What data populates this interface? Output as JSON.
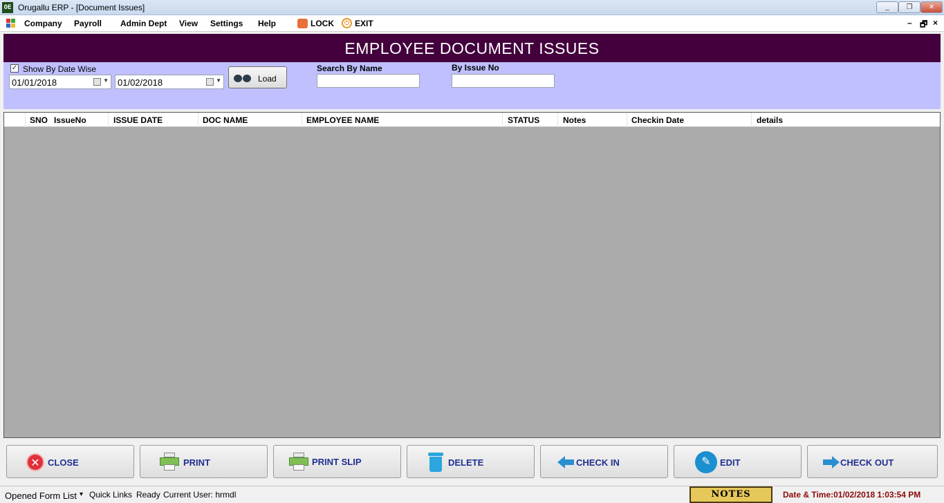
{
  "window": {
    "title": "Orugallu ERP - [Document Issues]",
    "app_icon_text": "OE",
    "minimize": "_",
    "restore": "❐",
    "close": "✕"
  },
  "menu": {
    "items": [
      "Company",
      "Payroll",
      "Admin Dept",
      "View",
      "Settings",
      "Help"
    ],
    "lock": "LOCK",
    "exit": "EXIT",
    "mdi_min": "–",
    "mdi_restore": "🗗",
    "mdi_close": "×"
  },
  "header": {
    "title": "EMPLOYEE DOCUMENT ISSUES"
  },
  "filters": {
    "show_by_date_wise_label": "Show By Date Wise",
    "show_by_date_wise_checked": true,
    "check_mark": "✓",
    "from_date": "01/01/2018",
    "to_date": "01/02/2018",
    "dropdown_arrow": "▼",
    "load_label": "Load",
    "search_by_name_label": "Search By Name",
    "search_by_name_value": "",
    "by_issue_no_label": "By  Issue No",
    "by_issue_no_value": ""
  },
  "grid": {
    "columns": [
      "SNO",
      "IssueNo",
      "ISSUE DATE",
      "DOC NAME",
      "EMPLOYEE NAME",
      "STATUS",
      "Notes",
      "Checkin Date",
      "details"
    ],
    "rows": []
  },
  "actions": {
    "close": "CLOSE",
    "print": "PRINT",
    "print_slip": "PRINT SLIP",
    "delete": "DELETE",
    "check_in": "CHECK IN",
    "edit": "EDIT",
    "check_out": "CHECK OUT",
    "close_icon_glyph": "✕",
    "edit_icon_glyph": "✎"
  },
  "status": {
    "opened_form_list": "Opened Form List",
    "opened_form_list_arrow": "▾",
    "quick_links": "Quick Links",
    "ready": "Ready",
    "current_user": "Current User: hrmdl",
    "notes": "NOTES",
    "datetime": "Date & Time:01/02/2018 1:03:54 PM"
  },
  "colors": {
    "banner": "#43003d",
    "filter_panel": "#c0c0fe",
    "grid_bg": "#ababab",
    "button_text": "#1f2f8f",
    "datetime_text": "#8b0a0a"
  }
}
